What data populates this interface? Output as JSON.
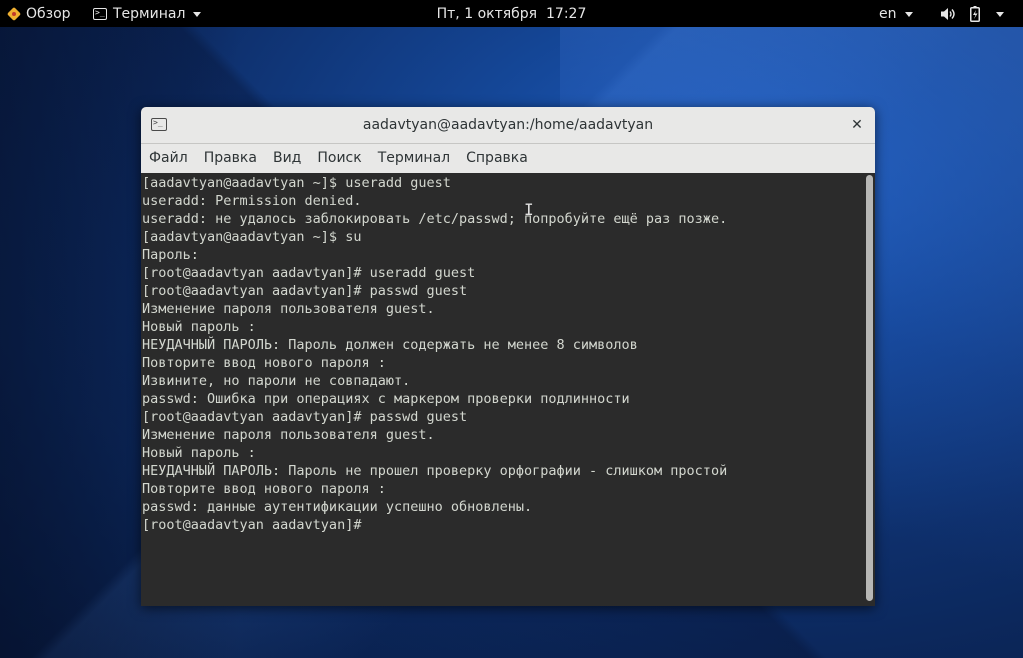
{
  "topbar": {
    "activities_label": "Обзор",
    "app_menu_label": "Терминал",
    "clock": "Пт, 1 октября  17:27",
    "language": "en",
    "volume_icon": "speaker-icon",
    "battery_icon": "battery-charging-icon"
  },
  "window": {
    "title": "aadavtyan@aadavtyan:/home/aadavtyan",
    "close_glyph": "✕",
    "menu": [
      "Файл",
      "Правка",
      "Вид",
      "Поиск",
      "Терминал",
      "Справка"
    ]
  },
  "terminal": {
    "lines": [
      "[aadavtyan@aadavtyan ~]$ useradd guest",
      "useradd: Permission denied.",
      "useradd: не удалось заблокировать /etc/passwd; попробуйте ещё раз позже.",
      "[aadavtyan@aadavtyan ~]$ su",
      "Пароль:",
      "[root@aadavtyan aadavtyan]# useradd guest",
      "[root@aadavtyan aadavtyan]# passwd guest",
      "Изменение пароля пользователя guest.",
      "Новый пароль :",
      "НЕУДАЧНЫЙ ПАРОЛЬ: Пароль должен содержать не менее 8 символов",
      "Повторите ввод нового пароля :",
      "Извините, но пароли не совпадают.",
      "passwd: Ошибка при операциях с маркером проверки подлинности",
      "[root@aadavtyan aadavtyan]# passwd guest",
      "Изменение пароля пользователя guest.",
      "Новый пароль :",
      "НЕУДАЧНЫЙ ПАРОЛЬ: Пароль не прошел проверку орфографии - слишком простой",
      "Повторите ввод нового пароля :",
      "passwd: данные аутентификации успешно обновлены.",
      "[root@aadavtyan aadavtyan]# "
    ]
  },
  "colors": {
    "topbar_bg": "#000000",
    "titlebar_bg": "#e8e8e7",
    "terminal_bg": "#2b2b2b",
    "terminal_fg": "#d3d7cf"
  }
}
